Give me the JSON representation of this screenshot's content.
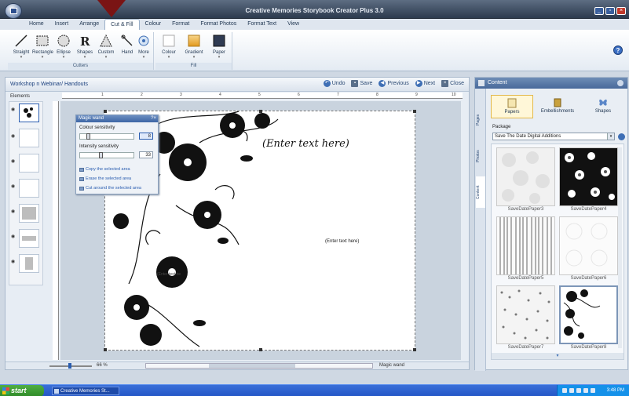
{
  "window": {
    "title": "Creative Memories Storybook Creator Plus 3.0"
  },
  "ribbon": {
    "tabs": [
      "Home",
      "Insert",
      "Arrange",
      "Cut & Fill",
      "Colour",
      "Format",
      "Format Photos",
      "Format Text",
      "View"
    ],
    "active_tab": "Cut & Fill",
    "cutters_group": {
      "label": "Cutters",
      "buttons": [
        "Straight",
        "Rectangle",
        "Ellipse",
        "Shapes",
        "Custom",
        "Hand",
        "More"
      ]
    },
    "fill_group": {
      "label": "Fill",
      "buttons": [
        "Colour",
        "Gradient",
        "Paper"
      ]
    }
  },
  "workspace": {
    "breadcrumb": "Workshop n Webinar/ Handouts",
    "actions": {
      "undo": "Undo",
      "save": "Save",
      "previous": "Previous",
      "next": "Next",
      "close": "Close"
    },
    "elements_label": "Elements",
    "ruler_numbers": [
      "1",
      "2",
      "3",
      "4",
      "5",
      "6",
      "7",
      "8",
      "9",
      "10"
    ],
    "page": {
      "script_placeholder": "(Enter text here)",
      "text_placeholder": "(Enter text here)",
      "small_placeholder": "(Enter text he"
    },
    "footer": {
      "zoom": "66 %",
      "status": "Magic wand"
    }
  },
  "magic_wand": {
    "title": "Magic wand",
    "colour_sensitivity_label": "Colour sensitivity",
    "colour_sensitivity_value": "8",
    "intensity_sensitivity_label": "Intensity sensitivity",
    "intensity_sensitivity_value": "33",
    "links": [
      "Copy the selected area",
      "Erase the selected area",
      "Cut around the selected area"
    ]
  },
  "content_panel": {
    "title": "Content",
    "side_tabs": [
      "Pages",
      "Photos",
      "Content"
    ],
    "tabs": [
      "Papers",
      "Embellishments",
      "Shapes"
    ],
    "active_tab": "Papers",
    "package_label": "Package",
    "package_value": "Save The Date Digital Additions",
    "items": [
      "SaveDatePaper3",
      "SaveDatePaper4",
      "SaveDatePaper5",
      "SaveDatePaper6",
      "SaveDatePaper7",
      "SaveDatePaper8"
    ]
  },
  "taskbar": {
    "start_label": "start",
    "task_item": "Creative Memories St...",
    "clock": "3:48 PM"
  },
  "colors": {
    "accent": "#2a5db0",
    "pointer": "#7a1414",
    "selected_tab": "#fff7d8"
  }
}
